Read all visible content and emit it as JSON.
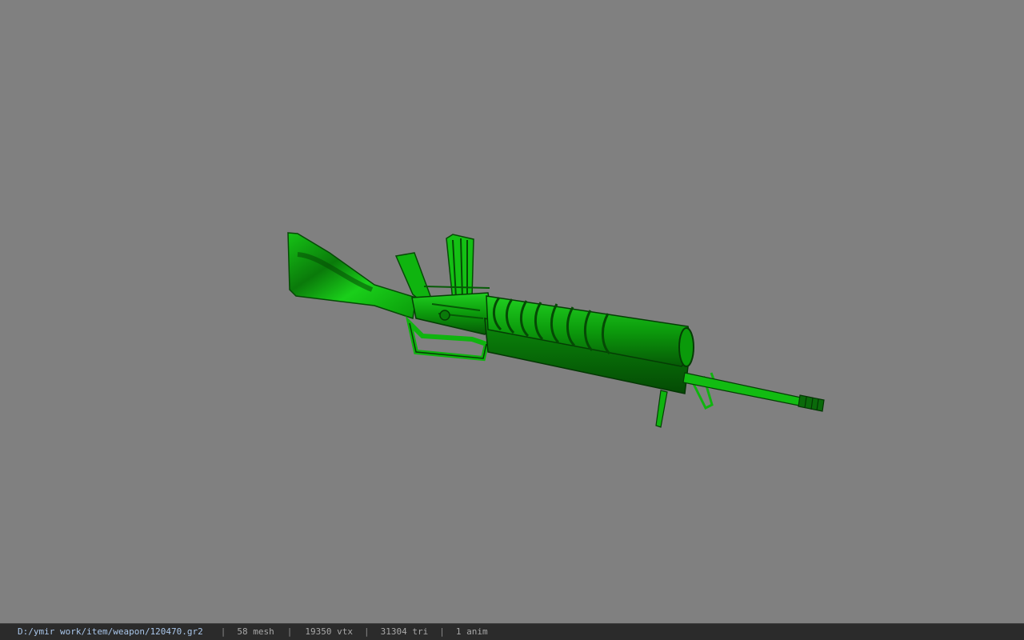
{
  "viewer": {
    "background_color": "#808080",
    "model": {
      "icon": "rifle-model-icon",
      "color": "#0a9a0a"
    }
  },
  "status_bar": {
    "file_path": "D:/ymir work/item/weapon/120470.gr2",
    "separator": "|",
    "mesh_count": "58 mesh",
    "vertex_count": "19350 vtx",
    "triangle_count": "31304 tri",
    "anim_count": "1 anim"
  }
}
